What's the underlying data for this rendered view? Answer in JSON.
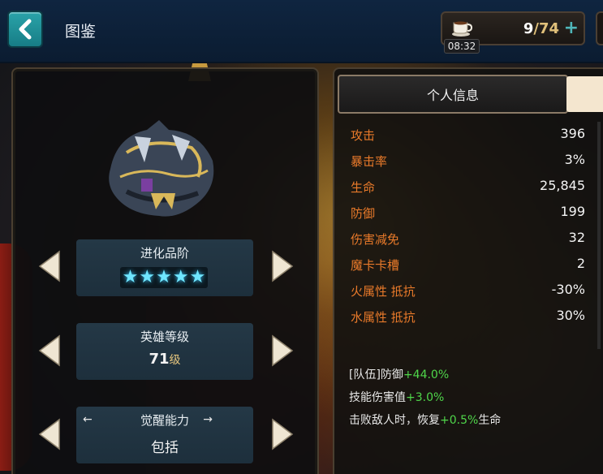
{
  "header": {
    "title": "图鉴",
    "stamina": {
      "current": "9",
      "separator": "/",
      "max": "74",
      "plus": "+",
      "timer": "08:32"
    }
  },
  "hero_panel": {
    "evolution": {
      "label": "进化品阶",
      "stars": 5
    },
    "level": {
      "label": "英雄等级",
      "value": "71",
      "unit": "级"
    },
    "awakening": {
      "label": "觉醒能力",
      "value": "包括",
      "left_arrow": "←",
      "right_arrow": "→"
    }
  },
  "tabs": {
    "personal": "个人信息"
  },
  "attributes": [
    {
      "name": "攻击",
      "value": "396"
    },
    {
      "name": "暴击率",
      "value": "3%"
    },
    {
      "name": "生命",
      "value": "25,845"
    },
    {
      "name": "防御",
      "value": "199"
    },
    {
      "name": "伤害减免",
      "value": "32"
    },
    {
      "name": "魔卡卡槽",
      "value": "2"
    },
    {
      "name": "火属性 抵抗",
      "value": "-30%"
    },
    {
      "name": "水属性 抵抗",
      "value": "30%"
    }
  ],
  "bonuses": [
    {
      "prefix": "[队伍]防御",
      "pct": "+44.0%",
      "suffix": ""
    },
    {
      "prefix": "技能伤害值",
      "pct": "+3.0%",
      "suffix": ""
    },
    {
      "prefix": "击败敌人时，恢复",
      "pct": "+0.5%",
      "suffix": "生命"
    }
  ],
  "colors": {
    "attr_name": "#e97a2a",
    "bonus_pct": "#4fd64a",
    "star": "#6fe6ff",
    "back_button": "#2aa3a9"
  },
  "icons": {
    "back": "chevron-left-icon",
    "stamina": "coffee-cup-icon",
    "prev": "triangle-left-icon",
    "next": "triangle-right-icon"
  }
}
